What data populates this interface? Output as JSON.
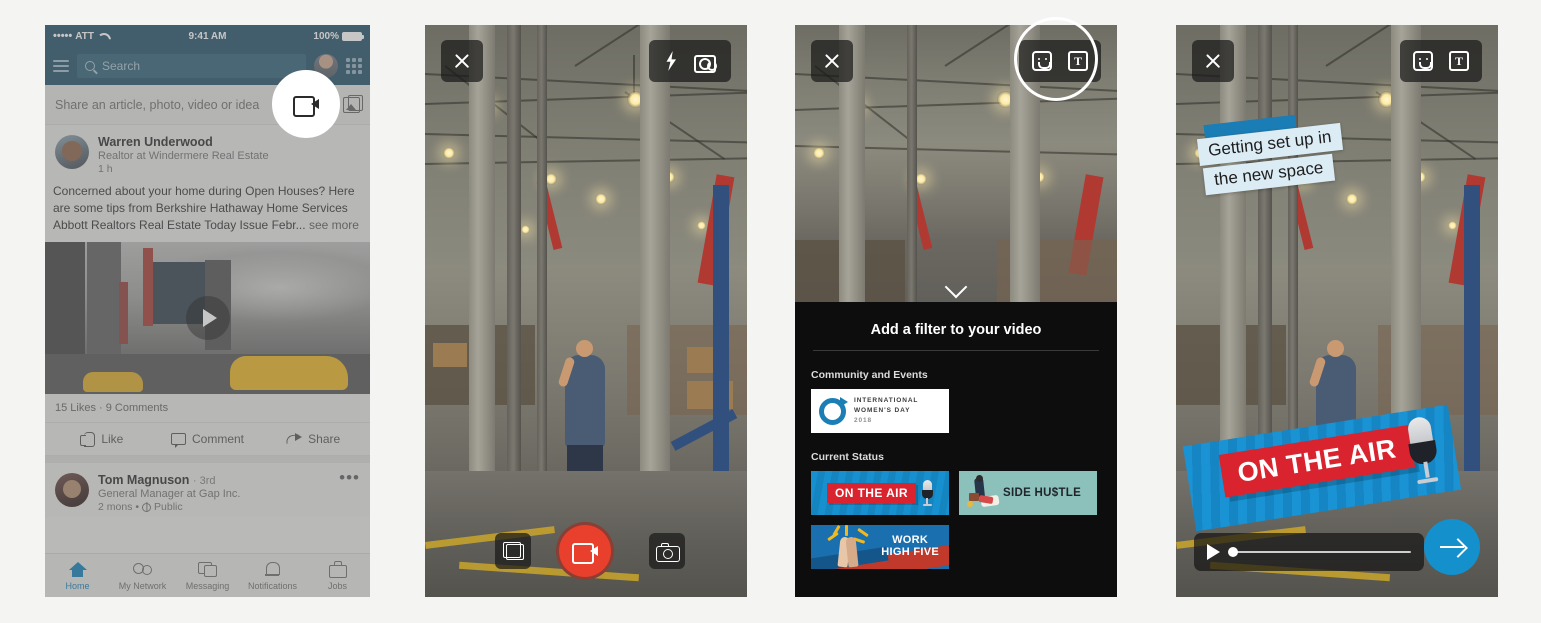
{
  "panels": {
    "feed": {
      "status_bar": {
        "carrier": "ATT",
        "signal_dots": "•••••",
        "time": "9:41 AM",
        "battery": "100%"
      },
      "nav": {
        "search_placeholder": "Search"
      },
      "composer": {
        "placeholder": "Share an article, photo, video or idea"
      },
      "posts": [
        {
          "author": "Warren Underwood",
          "headline": "Realtor at Windermere Real Estate",
          "time": "1 h",
          "body": "Concerned about your home during Open Houses?  Here are some tips from Berkshire Hathaway Home Services Abbott Realtors Real Estate Today Issue Febr...",
          "see_more": "see more",
          "counts": "15 Likes  ·  9 Comments",
          "actions": [
            "Like",
            "Comment",
            "Share"
          ]
        },
        {
          "author": "Tom Magnuson",
          "degree": "· 3rd",
          "headline": "General Manager at Gap Inc.",
          "time": "2 mons •",
          "visibility": "Public",
          "overflow": "•••"
        }
      ],
      "tabs": [
        {
          "label": "Home",
          "active": true
        },
        {
          "label": "My Network",
          "active": false
        },
        {
          "label": "Messaging",
          "active": false
        },
        {
          "label": "Notifications",
          "active": false
        },
        {
          "label": "Jobs",
          "active": false
        }
      ]
    },
    "camera": {
      "icons": {
        "close": "close-icon",
        "flash": "flash-icon",
        "flip": "camera-flip-icon",
        "gallery": "gallery-icon",
        "record": "record-video-icon",
        "photo": "photo-camera-icon"
      }
    },
    "filter_picker": {
      "title": "Add a filter to your video",
      "sections": [
        {
          "label": "Community and Events",
          "filters": [
            {
              "name": "INTERNATIONAL WOMEN'S DAY 2018",
              "line1": "INTERNATIONAL",
              "line2": "WOMEN'S DAY",
              "line3": "2018"
            }
          ]
        },
        {
          "label": "Current Status",
          "filters": [
            {
              "name": "ON THE AIR",
              "text": "ON THE AIR"
            },
            {
              "name": "SIDE HU$TLE",
              "text": "SIDE HU$TLE"
            },
            {
              "name": "WORK HIGH FIVE",
              "line1": "WORK",
              "line2": "HIGH FIVE"
            }
          ]
        }
      ]
    },
    "editor": {
      "caption_line1": "Getting set up in",
      "caption_line2": "the new space",
      "applied_filter": "ON THE AIR",
      "progress_percent": 0
    }
  },
  "colors": {
    "linkedin_blue": "#0a7bb5",
    "nav_bar": "#1c4b63",
    "record_red": "#e8402c",
    "filter_red": "#d9232e",
    "filter_blue": "#1a93d4",
    "next_button": "#1490cc",
    "caption_bg": "#dcecf5",
    "page_bg": "#f4f4f3"
  }
}
